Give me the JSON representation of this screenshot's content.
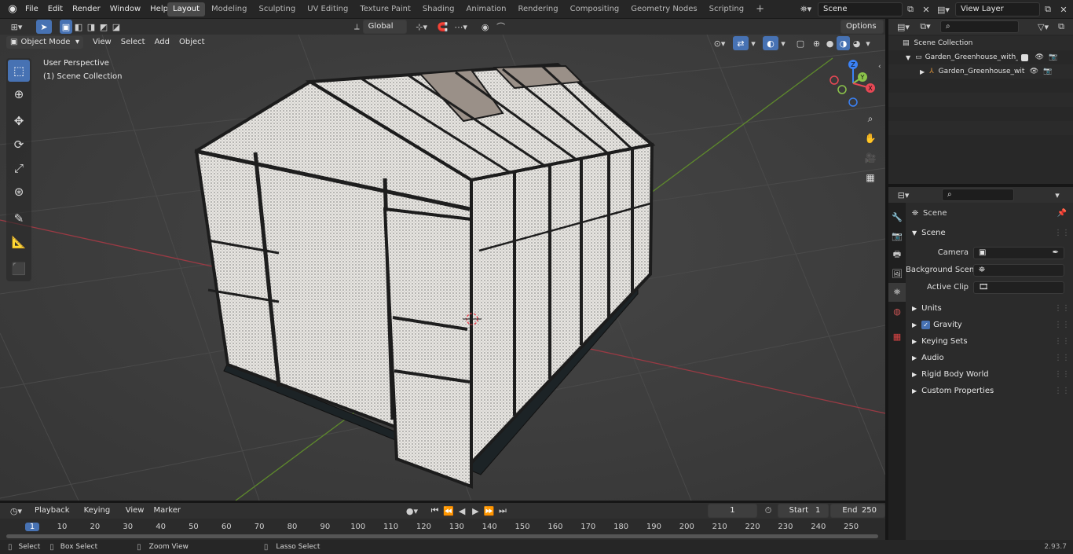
{
  "topbar": {
    "menus": [
      "File",
      "Edit",
      "Render",
      "Window",
      "Help"
    ],
    "workspaces": [
      "Layout",
      "Modeling",
      "Sculpting",
      "UV Editing",
      "Texture Paint",
      "Shading",
      "Animation",
      "Rendering",
      "Compositing",
      "Geometry Nodes",
      "Scripting"
    ],
    "active_workspace": "Layout",
    "add_tab": "+",
    "scene_name": "Scene",
    "view_layer": "View Layer"
  },
  "viewport_header": {
    "mode": "Object Mode",
    "menus": [
      "View",
      "Select",
      "Add",
      "Object"
    ],
    "transform": "Global",
    "options": "Options"
  },
  "viewport": {
    "perspective": "User Perspective",
    "collection": "(1) Scene Collection",
    "gizmo": {
      "z": "Z",
      "y": "Y",
      "x": "X"
    }
  },
  "outliner": {
    "root": "Scene Collection",
    "items": [
      {
        "label": "Garden_Greenhouse_with_Ra",
        "level": 1
      },
      {
        "label": "Garden_Greenhouse_witl",
        "level": 2
      }
    ]
  },
  "properties": {
    "breadcrumb": "Scene",
    "section": "Scene",
    "fields": [
      {
        "label": "Camera",
        "value": ""
      },
      {
        "label": "Background Scene",
        "value": ""
      },
      {
        "label": "Active Clip",
        "value": ""
      }
    ],
    "panels": [
      "Units",
      "Gravity",
      "Keying Sets",
      "Audio",
      "Rigid Body World",
      "Custom Properties"
    ],
    "gravity_checked": true
  },
  "timeline": {
    "menus": [
      "Playback",
      "Keying",
      "View",
      "Marker"
    ],
    "current_frame": "1",
    "start_label": "Start",
    "start": "1",
    "end_label": "End",
    "end": "250",
    "ticks": [
      "1",
      "10",
      "20",
      "30",
      "40",
      "50",
      "60",
      "70",
      "80",
      "90",
      "100",
      "110",
      "120",
      "130",
      "140",
      "150",
      "160",
      "170",
      "180",
      "190",
      "200",
      "210",
      "220",
      "230",
      "240",
      "250"
    ]
  },
  "statusbar": {
    "items": [
      "Select",
      "Box Select",
      "Zoom View",
      "Lasso Select"
    ],
    "version": "2.93.7"
  },
  "colors": {
    "accent": "#4772b3",
    "x_axis": "#e84855",
    "y_axis": "#8bc34a",
    "z_axis": "#3b82f6"
  }
}
